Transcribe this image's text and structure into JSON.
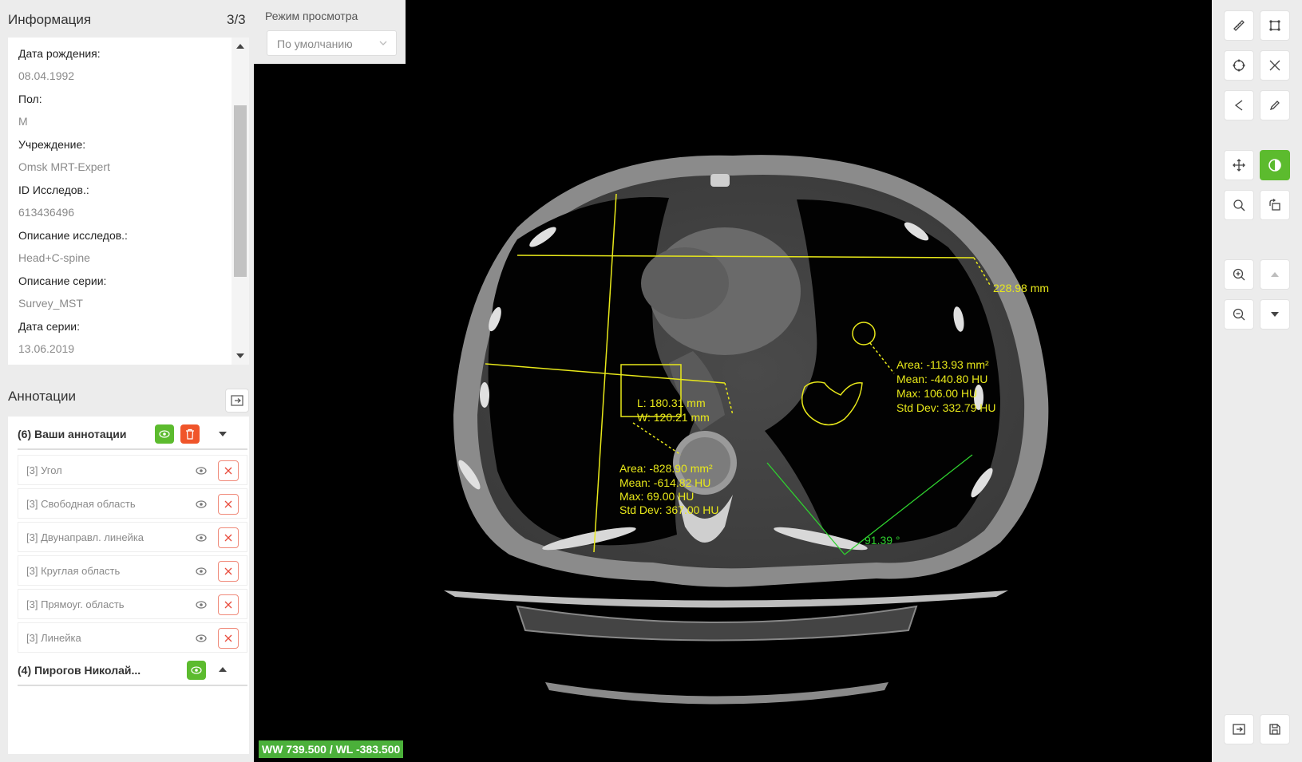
{
  "info_panel": {
    "title": "Информация",
    "count": "3/3",
    "fields": [
      {
        "label": "Дата рождения:",
        "value": "08.04.1992"
      },
      {
        "label": "Пол:",
        "value": "M"
      },
      {
        "label": "Учреждение:",
        "value": "Omsk MRT-Expert"
      },
      {
        "label": "ID Исследов.:",
        "value": "613436496"
      },
      {
        "label": "Описание исследов.:",
        "value": "Head+C-spine"
      },
      {
        "label": "Описание серии:",
        "value": "Survey_MST"
      },
      {
        "label": "Дата серии:",
        "value": "13.06.2019"
      }
    ]
  },
  "annotations_panel": {
    "title": "Аннотации",
    "groups": [
      {
        "title": "(6) Ваши аннотации",
        "expanded": true,
        "items": [
          {
            "label": "[3] Угол"
          },
          {
            "label": "[3] Свободная область"
          },
          {
            "label": "[3] Двунаправл. линейка"
          },
          {
            "label": "[3] Круглая область"
          },
          {
            "label": "[3] Прямоуг. область"
          },
          {
            "label": "[3] Линейка"
          }
        ]
      },
      {
        "title": "(4) Пирогов Николай...",
        "expanded": false,
        "items": []
      }
    ]
  },
  "view_mode": {
    "title": "Режим просмотра",
    "value": "По умолчанию"
  },
  "viewer": {
    "wwwl": "WW 739.500 / WL -383.500",
    "annotations": {
      "length": "228.98 mm",
      "ellipse_stats": [
        "Area: -113.93 mm²",
        "Mean: -440.80 HU",
        "Max: 106.00 HU",
        "Std Dev: 332.79 HU"
      ],
      "bidir": [
        "L: 180.31 mm",
        "W: 120.21 mm"
      ],
      "rect_stats": [
        "Area: -828.90 mm²",
        "Mean: -614.82 HU",
        "Max: 69.00 HU",
        "Std Dev: 367.00 HU"
      ],
      "angle": "91.39 °"
    },
    "colors": {
      "annotation": "#e8e81a",
      "angle": "#2fd12f",
      "accent_green": "#5cbb2e",
      "danger": "#f0552a"
    }
  },
  "toolbar": {
    "tools": [
      {
        "name": "ruler-icon",
        "active": false
      },
      {
        "name": "rect-roi-icon",
        "active": false
      },
      {
        "name": "ellipse-roi-icon",
        "active": false
      },
      {
        "name": "bidirectional-icon",
        "active": false
      },
      {
        "name": "angle-icon",
        "active": false
      },
      {
        "name": "pencil-icon",
        "active": false
      },
      {
        "name": "pan-icon",
        "active": false
      },
      {
        "name": "contrast-icon",
        "active": true
      },
      {
        "name": "magnify-icon",
        "active": false
      },
      {
        "name": "rotate-icon",
        "active": false
      },
      {
        "name": "zoom-in-icon",
        "active": false
      },
      {
        "name": "scroll-up-icon",
        "active": false
      },
      {
        "name": "zoom-out-icon",
        "active": false
      },
      {
        "name": "scroll-down-icon",
        "active": false
      },
      {
        "name": "export-icon",
        "active": false
      },
      {
        "name": "save-icon",
        "active": false
      }
    ]
  }
}
